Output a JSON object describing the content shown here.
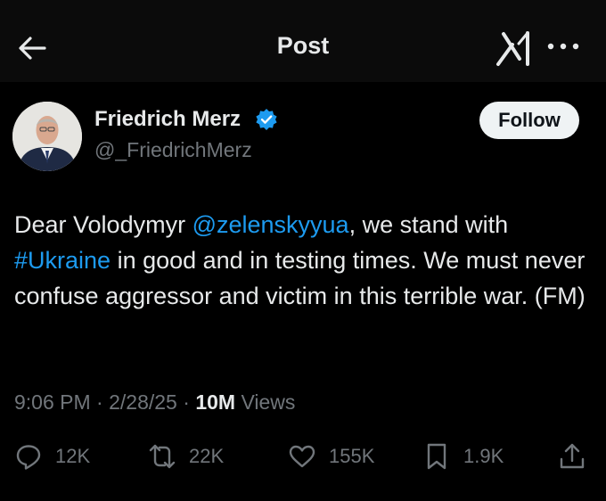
{
  "header": {
    "title": "Post",
    "icons": [
      "back-arrow-icon",
      "grok-icon",
      "more-icon"
    ]
  },
  "author": {
    "name": "Friedrich Merz",
    "handle": "@_FriedrichMerz",
    "verified": true,
    "follow_label": "Follow"
  },
  "tweet": {
    "part1": "Dear Volodymyr ",
    "mention": "@zelenskyyua",
    "part2": ", we stand with",
    "hashtag": "#Ukraine",
    "part3": " in good and in testing times. We must never confuse aggressor and victim in this terrible war. (FM)"
  },
  "meta": {
    "time": "9:06 PM",
    "sep1": " · ",
    "date": "2/28/25",
    "sep2": " · ",
    "views_count": "10M",
    "views_label": " Views"
  },
  "actions": {
    "reply": "12K",
    "retweet": "22K",
    "like": "155K",
    "bookmark": "1.9K"
  },
  "colors": {
    "background": "#000000",
    "header_background": "#0b0b0b",
    "text": "#e7e9ea",
    "secondary_text": "#71767b",
    "link": "#1d9bf0",
    "verified": "#1d9bf0"
  }
}
